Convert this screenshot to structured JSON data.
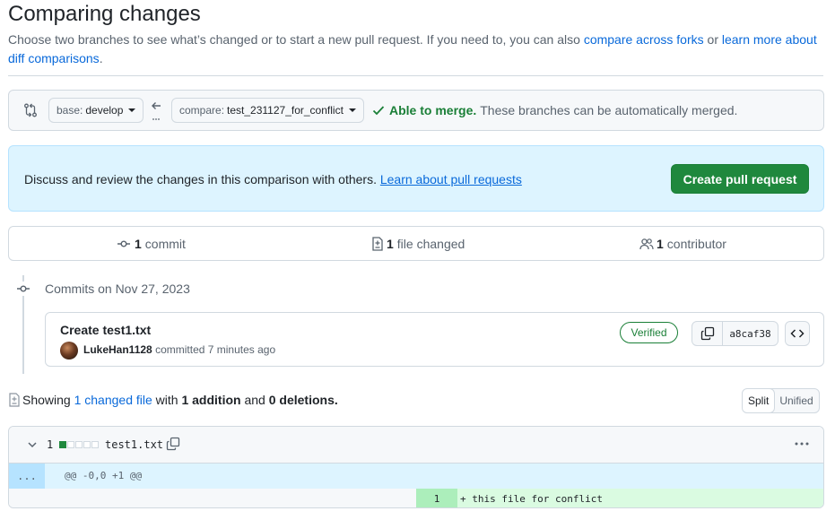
{
  "page": {
    "title": "Comparing changes",
    "subtitle_prefix": "Choose two branches to see what’s changed or to start a new pull request. If you need to, you can also",
    "subtitle_link1": "compare across forks",
    "subtitle_or": "or",
    "subtitle_link2": "learn more about diff comparisons",
    "subtitle_end": "."
  },
  "range": {
    "base_label": "base:",
    "base_branch": "develop",
    "compare_label": "compare:",
    "compare_branch": "test_231127_for_conflict",
    "merge_ok": "Able to merge.",
    "merge_text": "These branches can be automatically merged."
  },
  "blankslate": {
    "text": "Discuss and review the changes in this comparison with others.",
    "link": "Learn about pull requests",
    "button": "Create pull request"
  },
  "summary": {
    "commits_count": "1",
    "commits_label": "commit",
    "files_count": "1",
    "files_label": "file changed",
    "contributors_count": "1",
    "contributors_label": "contributor"
  },
  "commits": {
    "date_label": "Commits on Nov 27, 2023",
    "items": [
      {
        "title": "Create test1.txt",
        "author": "LukeHan1128",
        "meta": "committed 7 minutes ago",
        "badge": "Verified",
        "sha": "a8caf38"
      }
    ]
  },
  "toc": {
    "showing": "Showing",
    "changed_link": "1 changed file",
    "with": "with",
    "additions": "1 addition",
    "and": "and",
    "deletions": "0 deletions.",
    "split": "Split",
    "unified": "Unified"
  },
  "file": {
    "diffstat": "1",
    "additions": 1,
    "blocks_total": 5,
    "name": "test1.txt",
    "expander": "...",
    "hunk": "@@ -0,0 +1 @@",
    "lines": [
      {
        "num": "1",
        "code": "+ this file for conflict"
      }
    ]
  },
  "colors": {
    "accent": "#0969da",
    "success": "#1f883d",
    "addition_bg": "#dafbe1",
    "hunk_bg": "#ddf4ff"
  }
}
